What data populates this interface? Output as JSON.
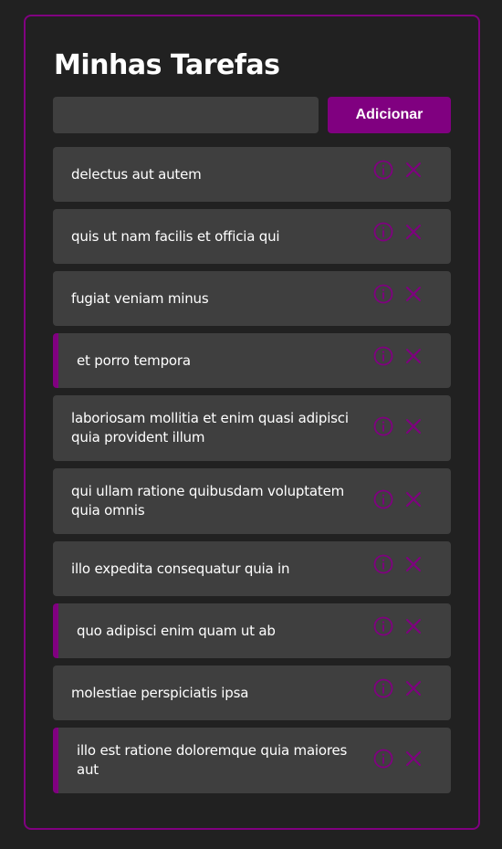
{
  "header": {
    "title": "Minhas Tarefas"
  },
  "form": {
    "input_value": "",
    "input_placeholder": "",
    "add_label": "Adicionar"
  },
  "colors": {
    "accent": "#800080",
    "background": "#212121",
    "card": "#3f3f3f",
    "text": "#ffffff"
  },
  "icons": {
    "info": "info-circle-icon",
    "remove": "close-icon"
  },
  "tasks": [
    {
      "title": "delectus aut autem",
      "completed": false
    },
    {
      "title": "quis ut nam facilis et officia qui",
      "completed": false
    },
    {
      "title": "fugiat veniam minus",
      "completed": false
    },
    {
      "title": "et porro tempora",
      "completed": true
    },
    {
      "title": "laboriosam mollitia et enim quasi adipisci quia provident illum",
      "completed": false
    },
    {
      "title": "qui ullam ratione quibusdam voluptatem quia omnis",
      "completed": false
    },
    {
      "title": "illo expedita consequatur quia in",
      "completed": false
    },
    {
      "title": "quo adipisci enim quam ut ab",
      "completed": true
    },
    {
      "title": "molestiae perspiciatis ipsa",
      "completed": false
    },
    {
      "title": "illo est ratione doloremque quia maiores aut",
      "completed": true
    }
  ]
}
